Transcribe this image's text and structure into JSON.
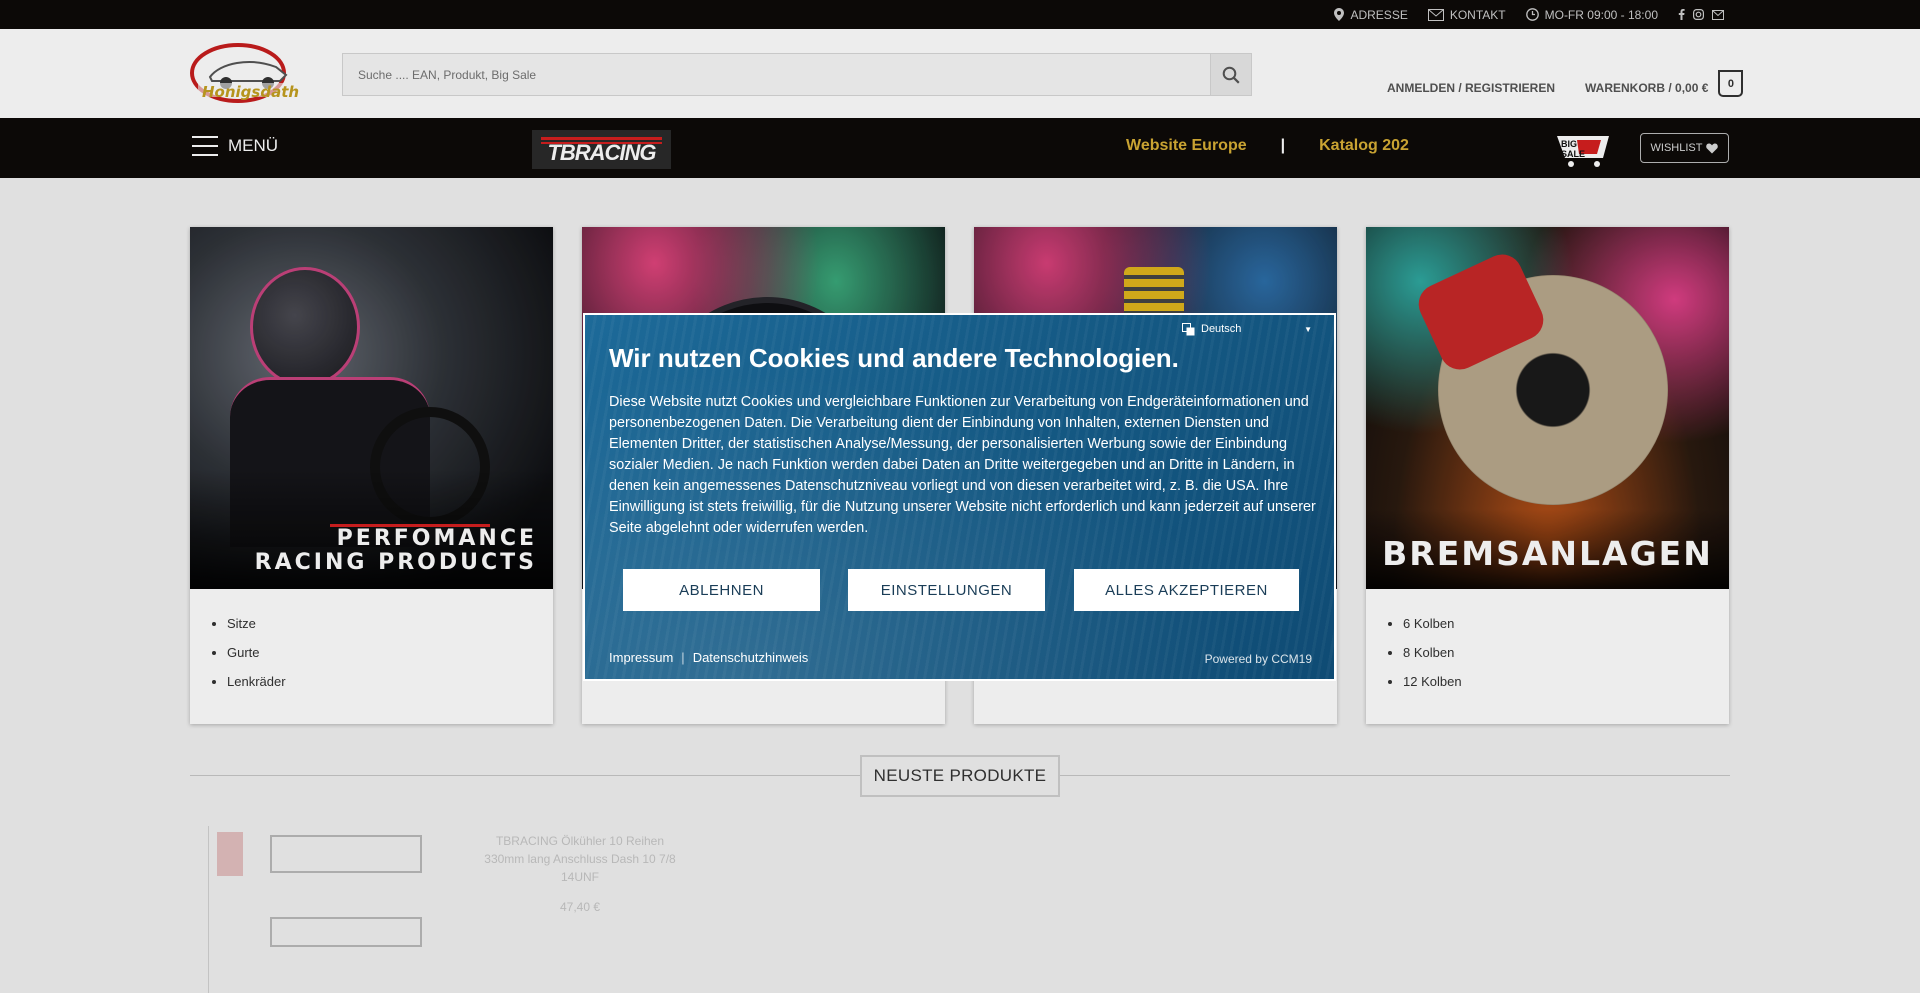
{
  "topbar": {
    "address": "ADRESSE",
    "contact": "KONTAKT",
    "hours": "MO-FR 09:00 - 18:00"
  },
  "header": {
    "logo_text": "Honigsdath",
    "search_placeholder": "Suche .... EAN, Produkt, Big Sale",
    "login": "ANMELDEN / REGISTRIEREN",
    "cart_label": "WARENKORB / 0,00 €",
    "cart_count": "0"
  },
  "nav": {
    "menu": "MENÜ",
    "brand": "TBRACING",
    "links": [
      "Website Europe",
      "|",
      "Katalog 202"
    ],
    "bigsale": "BIG SALE",
    "wishlist": "WISHLIST"
  },
  "cards": [
    {
      "title_line1": "PERFOMANCE",
      "title_line2": "RACING PRODUCTS",
      "items": [
        "Sitze",
        "Gurte",
        "Lenkräder"
      ]
    },
    {
      "title_line1": "",
      "title_line2": "",
      "items": []
    },
    {
      "title_line1": "",
      "title_line2": "",
      "items": []
    },
    {
      "title_line1": "BREMSANLAGEN",
      "title_line2": "",
      "items": [
        "6 Kolben",
        "8 Kolben",
        "12 Kolben"
      ]
    }
  ],
  "section": {
    "newest": "NEUSTE PRODUKTE"
  },
  "products": {
    "name": "TBRACING Ölkühler 10 Reihen 330mm lang Anschluss Dash 10 7/8 14UNF",
    "price": "47,40 €"
  },
  "cookie": {
    "language": "Deutsch",
    "title": "Wir nutzen Cookies und andere Technologien.",
    "text": "Diese Website nutzt Cookies und vergleichbare Funktionen zur Verarbeitung von Endgeräteinformationen und personenbezogenen Daten. Die Verarbeitung dient der Einbindung von Inhalten, externen Diensten und Elementen Dritter, der statistischen Analyse/Messung, der personalisierten Werbung sowie der Einbindung sozialer Medien. Je nach Funktion werden dabei Daten an Dritte weitergegeben und an Dritte in Ländern, in denen kein angemessenes Datenschutzniveau vorliegt und von diesen verarbeitet wird, z. B. die USA. Ihre Einwilligung ist stets freiwillig, für die Nutzung unserer Website nicht erforderlich und kann jederzeit auf unserer Seite abgelehnt oder widerrufen werden.",
    "reject": "ABLEHNEN",
    "settings": "EINSTELLUNGEN",
    "accept": "ALLES AKZEPTIEREN",
    "imprint": "Impressum",
    "privacy": "Datenschutzhinweis",
    "powered": "Powered by CCM19"
  },
  "colors": {
    "dark": "#0d0a08",
    "gold": "#d9b036",
    "modal": "#155a85"
  }
}
